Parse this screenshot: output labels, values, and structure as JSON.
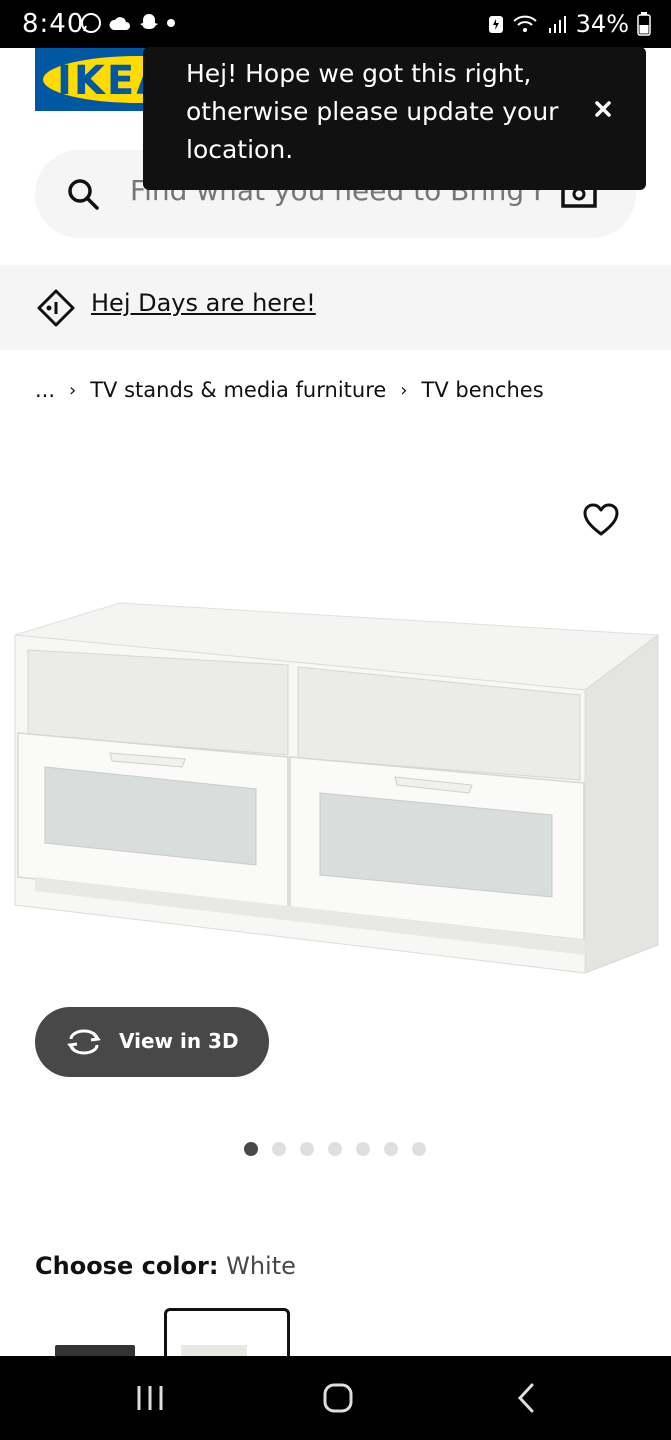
{
  "status_bar": {
    "time": "8:40",
    "battery": "34%"
  },
  "header": {
    "logo_text": "IKEA",
    "search": {
      "placeholder": "Find what you need to Bring Hc"
    }
  },
  "tooltip": {
    "message": "Hej! Hope we got this right, otherwise please update your location."
  },
  "promo": {
    "link_text": "Hej Days are here!"
  },
  "breadcrumb": {
    "items": [
      "...",
      "TV stands & media furniture",
      "TV benches"
    ]
  },
  "product": {
    "view_3d_label": "View in 3D",
    "image_count": 7,
    "active_image": 1,
    "choose_color_label": "Choose color:",
    "selected_color": "White"
  },
  "colors": {
    "ikea_blue": "#0058a3",
    "ikea_yellow": "#ffdb00",
    "tooltip_bg": "#111111",
    "button_bg": "#484848"
  }
}
